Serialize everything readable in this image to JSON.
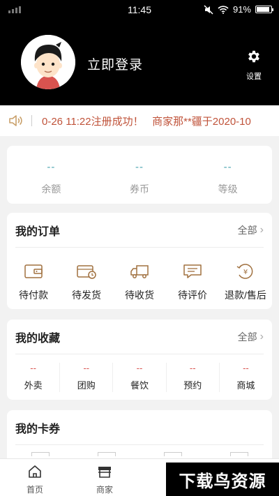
{
  "status_bar": {
    "time": "11:45",
    "battery": "91%",
    "battery_level": 0.91
  },
  "profile": {
    "login_label": "立即登录",
    "settings_label": "设置"
  },
  "notice": {
    "text": "0-26 11:22注册成功！   商家那**疆于2020-10"
  },
  "stats": [
    {
      "value": "--",
      "label": "余额"
    },
    {
      "value": "--",
      "label": "券币"
    },
    {
      "value": "--",
      "label": "等级"
    }
  ],
  "orders": {
    "title": "我的订单",
    "more": "全部",
    "items": [
      {
        "label": "待付款",
        "icon": "wallet-icon"
      },
      {
        "label": "待发货",
        "icon": "package-clock-icon"
      },
      {
        "label": "待收货",
        "icon": "truck-icon"
      },
      {
        "label": "待评价",
        "icon": "comment-icon"
      },
      {
        "label": "退款/售后",
        "icon": "refund-icon"
      }
    ]
  },
  "favorites": {
    "title": "我的收藏",
    "more": "全部",
    "items": [
      {
        "value": "--",
        "label": "外卖"
      },
      {
        "value": "--",
        "label": "团购"
      },
      {
        "value": "--",
        "label": "餐饮"
      },
      {
        "value": "--",
        "label": "预约"
      },
      {
        "value": "--",
        "label": "商城"
      }
    ]
  },
  "cards": {
    "title": "我的卡券"
  },
  "tabbar": [
    {
      "label": "首页",
      "icon": "home-icon"
    },
    {
      "label": "商家",
      "icon": "store-icon"
    },
    {
      "label": "",
      "icon": ""
    },
    {
      "label": "",
      "icon": ""
    }
  ],
  "watermark": "下载鸟资源"
}
